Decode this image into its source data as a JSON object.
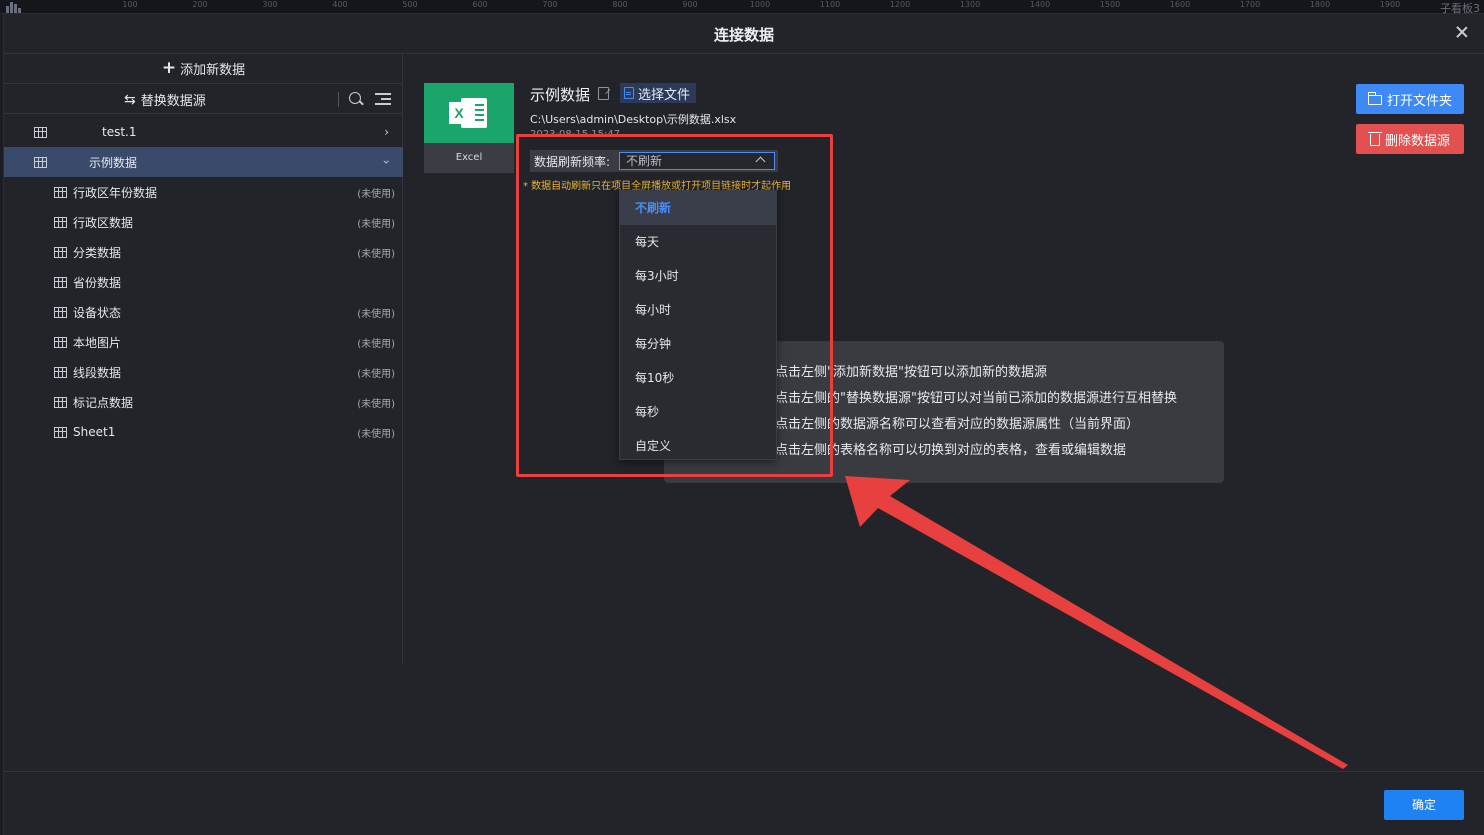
{
  "background": {
    "ruler_ticks": [
      "100",
      "200",
      "300",
      "400",
      "500",
      "600",
      "700",
      "800",
      "900",
      "1000",
      "1100",
      "1200",
      "1300",
      "1400",
      "1500",
      "1600",
      "1700",
      "1800",
      "1900"
    ],
    "sub_tab": "子看板3"
  },
  "modal": {
    "title": "连接数据"
  },
  "sidebar": {
    "add_label": "添加新数据",
    "replace_label": "替换数据源",
    "sources": [
      {
        "name": "test.1",
        "expanded": false
      },
      {
        "name": "示例数据",
        "expanded": true
      }
    ],
    "tables": [
      {
        "name": "行政区年份数据",
        "status": "(未使用)"
      },
      {
        "name": "行政区数据",
        "status": "(未使用)"
      },
      {
        "name": "分类数据",
        "status": "(未使用)"
      },
      {
        "name": "省份数据",
        "status": ""
      },
      {
        "name": "设备状态",
        "status": "(未使用)"
      },
      {
        "name": "本地图片",
        "status": "(未使用)"
      },
      {
        "name": "线段数据",
        "status": "(未使用)"
      },
      {
        "name": "标记点数据",
        "status": "(未使用)"
      },
      {
        "name": "Sheet1",
        "status": "(未使用)"
      }
    ]
  },
  "datasource": {
    "type_label": "Excel",
    "name": "示例数据",
    "choose_file": "选择文件",
    "path": "C:\\Users\\admin\\Desktop\\示例数据.xlsx",
    "date": "2023-08-15 15:47",
    "refresh_label": "数据刷新频率:",
    "refresh_value": "不刷新",
    "note": "* 数据自动刷新只在项目全屏播放或打开项目链接时才起作用"
  },
  "dropdown": {
    "options": [
      "不刷新",
      "每天",
      "每3小时",
      "每小时",
      "每分钟",
      "每10秒",
      "每秒",
      "自定义"
    ],
    "selected_index": 0
  },
  "tips": [
    "点击左侧\"添加新数据\"按钮可以添加新的数据源",
    "点击左侧的\"替换数据源\"按钮可以对当前已添加的数据源进行互相替换",
    "点击左侧的数据源名称可以查看对应的数据源属性（当前界面）",
    "点击左侧的表格名称可以切换到对应的表格，查看或编辑数据"
  ],
  "actions": {
    "open_folder": "打开文件夹",
    "delete_source": "删除数据源",
    "confirm": "确定"
  },
  "colors": {
    "accent": "#3d8af7",
    "danger": "#e2504f",
    "excel_green": "#1ba56b",
    "annotation_red": "#e8403e",
    "warning": "#e8b339"
  }
}
